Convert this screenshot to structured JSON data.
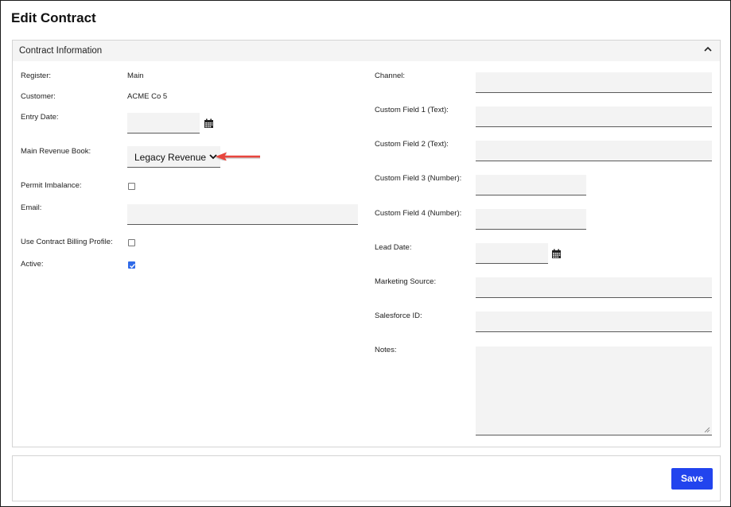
{
  "page": {
    "title": "Edit Contract"
  },
  "panel": {
    "title": "Contract Information",
    "collapse_icon": "chevron-up-icon"
  },
  "left": {
    "register": {
      "label": "Register:",
      "value": "Main"
    },
    "customer": {
      "label": "Customer:",
      "value": "ACME Co 5"
    },
    "entry_date": {
      "label": "Entry Date:",
      "value": "",
      "icon": "calendar-icon"
    },
    "main_revenue_book": {
      "label": "Main Revenue Book:",
      "selected": "Legacy Revenue",
      "icon": "chevron-down-icon"
    },
    "permit_imbalance": {
      "label": "Permit Imbalance:",
      "checked": false
    },
    "email": {
      "label": "Email:",
      "value": ""
    },
    "use_contract_billing_profile": {
      "label": "Use Contract Billing Profile:",
      "checked": false
    },
    "active": {
      "label": "Active:",
      "checked": true
    }
  },
  "right": {
    "channel": {
      "label": "Channel:",
      "value": ""
    },
    "custom_field_1": {
      "label": "Custom Field 1 (Text):",
      "value": ""
    },
    "custom_field_2": {
      "label": "Custom Field 2 (Text):",
      "value": ""
    },
    "custom_field_3": {
      "label": "Custom Field 3 (Number):",
      "value": ""
    },
    "custom_field_4": {
      "label": "Custom Field 4 (Number):",
      "value": ""
    },
    "lead_date": {
      "label": "Lead Date:",
      "value": "",
      "icon": "calendar-icon"
    },
    "marketing_source": {
      "label": "Marketing Source:",
      "value": ""
    },
    "salesforce_id": {
      "label": "Salesforce ID:",
      "value": ""
    },
    "notes": {
      "label": "Notes:",
      "value": ""
    }
  },
  "annotation": {
    "icon": "red-arrow-icon",
    "color": "#e8453c"
  },
  "footer": {
    "save_label": "Save"
  },
  "colors": {
    "accent": "#2244ee",
    "checkbox_checked": "#2f6ae8",
    "input_bg": "#f3f3f3"
  }
}
